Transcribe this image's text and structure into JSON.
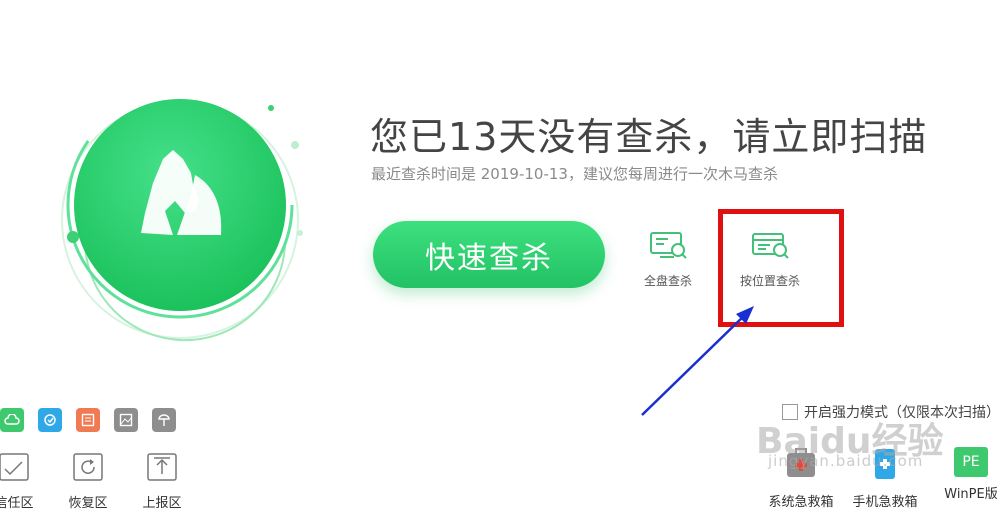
{
  "headline": "您已13天没有查杀，请立即扫描",
  "subline": "最近查杀时间是 2019-10-13，建议您每周进行一次木马查杀",
  "quick_scan_label": "快速查杀",
  "tools": {
    "full_disk": {
      "label": "全盘查杀",
      "icon": "full-disk-scan-icon"
    },
    "by_location": {
      "label": "按位置查杀",
      "icon": "location-scan-icon"
    }
  },
  "bottom_left_small_icons": [
    {
      "name": "cloud-icon",
      "color": "#3ec96f"
    },
    {
      "name": "refresh-icon",
      "color": "#2fa8e8"
    },
    {
      "name": "list-icon",
      "color": "#f07a52"
    },
    {
      "name": "image-icon",
      "color": "#8e8e8e"
    },
    {
      "name": "network-icon",
      "color": "#8e8e8e"
    }
  ],
  "bottom_left_tools": [
    {
      "label": "信任区",
      "icon": "trust-zone-icon"
    },
    {
      "label": "恢复区",
      "icon": "restore-zone-icon"
    },
    {
      "label": "上报区",
      "icon": "upload-zone-icon"
    }
  ],
  "protect_mode": {
    "label": "开启强力模式（仅限本次扫描）",
    "checked": false
  },
  "bottom_right_tools": [
    {
      "label": "系统急救箱",
      "icon": "system-rescue-icon"
    },
    {
      "label": "手机急救箱",
      "icon": "phone-rescue-icon"
    },
    {
      "label": "WinPE版",
      "icon": "winpe-icon",
      "badge": "PE"
    }
  ],
  "watermark": {
    "main": "Baidu经验",
    "sub": "jingyan.baidu.com"
  },
  "colors": {
    "accent": "#2bcf6d",
    "highlight": "#e01010",
    "arrow": "#1a2fd0"
  }
}
